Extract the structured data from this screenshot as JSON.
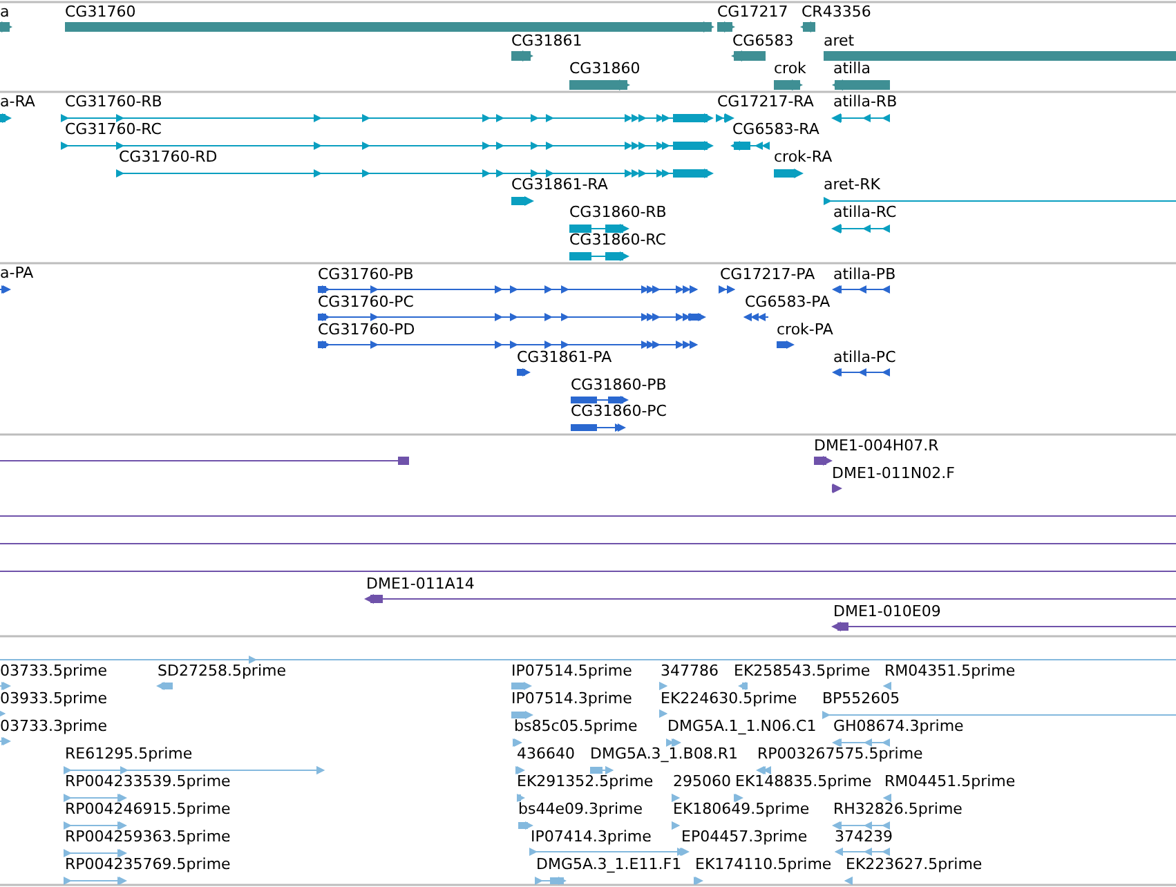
{
  "tracks": [
    {
      "kind": "gene",
      "color": "#3f8f94",
      "features": [
        {
          "label": "a",
          "reverse": false
        },
        {
          "label": "CG31760",
          "reverse": false
        },
        {
          "label": "CG17217",
          "reverse": false
        },
        {
          "label": "CR43356",
          "reverse": true
        },
        {
          "label": "CG31861",
          "reverse": false
        },
        {
          "label": "CG6583",
          "reverse": true
        },
        {
          "label": "aret"
        },
        {
          "label": "CG31860",
          "reverse": false
        },
        {
          "label": "crok",
          "reverse": false
        },
        {
          "label": "atilla",
          "reverse": true
        }
      ]
    },
    {
      "kind": "transcript",
      "color": "#0a9fc0",
      "features": [
        {
          "label": "a-RA",
          "reverse": false
        },
        {
          "label": "CG31760-RB",
          "reverse": false
        },
        {
          "label": "CG17217-RA",
          "reverse": false
        },
        {
          "label": "atilla-RB",
          "reverse": true
        },
        {
          "label": "CG31760-RC",
          "reverse": false
        },
        {
          "label": "CG6583-RA",
          "reverse": true
        },
        {
          "label": "CG31760-RD",
          "reverse": false
        },
        {
          "label": "crok-RA",
          "reverse": false
        },
        {
          "label": "CG31861-RA",
          "reverse": false
        },
        {
          "label": "aret-RK",
          "reverse": false
        },
        {
          "label": "CG31860-RB",
          "reverse": false
        },
        {
          "label": "atilla-RC",
          "reverse": true
        },
        {
          "label": "CG31860-RC",
          "reverse": false
        }
      ]
    },
    {
      "kind": "protein",
      "color": "#2a68d0",
      "features": [
        {
          "label": "a-PA",
          "reverse": false
        },
        {
          "label": "CG31760-PB",
          "reverse": false
        },
        {
          "label": "CG17217-PA",
          "reverse": false
        },
        {
          "label": "atilla-PB",
          "reverse": true
        },
        {
          "label": "CG31760-PC",
          "reverse": false
        },
        {
          "label": "CG6583-PA",
          "reverse": true
        },
        {
          "label": "CG31760-PD",
          "reverse": false
        },
        {
          "label": "crok-PA",
          "reverse": false
        },
        {
          "label": "CG31861-PA",
          "reverse": false
        },
        {
          "label": "atilla-PC",
          "reverse": true
        },
        {
          "label": "CG31860-PB",
          "reverse": false
        },
        {
          "label": "CG31860-PC",
          "reverse": false
        }
      ]
    },
    {
      "kind": "clone",
      "color": "#6f52aa",
      "features": [
        {
          "kind": "span"
        },
        {
          "kind": "clone",
          "label": "DME1-004H07.R",
          "reverse": false
        },
        {
          "kind": "clone",
          "label": "DME1-011N02.F",
          "reverse": false
        },
        {
          "kind": "span"
        },
        {
          "kind": "span"
        },
        {
          "kind": "span"
        },
        {
          "kind": "clone",
          "label": "DME1-011A14",
          "reverse": true
        },
        {
          "kind": "clone",
          "label": "DME1-010E09",
          "reverse": true
        }
      ]
    },
    {
      "kind": "est",
      "color": "#84b9de",
      "features": [
        {
          "reverse": false
        },
        {
          "label": "03733.5prime",
          "reverse": false
        },
        {
          "label": "SD27258.5prime",
          "reverse": true
        },
        {
          "label": "IP07514.5prime",
          "reverse": false
        },
        {
          "label": "347786",
          "reverse": false
        },
        {
          "label": "EK258543.5prime",
          "reverse": true
        },
        {
          "label": "RM04351.5prime",
          "reverse": true
        },
        {
          "label": "03933.5prime",
          "reverse": false
        },
        {
          "label": "IP07514.3prime",
          "reverse": false
        },
        {
          "label": "EK224630.5prime",
          "reverse": false
        },
        {
          "label": "BP552605",
          "reverse": false
        },
        {
          "label": "03733.3prime",
          "reverse": false
        },
        {
          "label": "bs85c05.5prime",
          "reverse": false
        },
        {
          "label": "DMG5A.1_1.N06.C1",
          "reverse": false
        },
        {
          "label": "GH08674.3prime",
          "reverse": true
        },
        {
          "label": "RE61295.5prime",
          "reverse": false
        },
        {
          "label": "436640",
          "reverse": false
        },
        {
          "label": "DMG5A.3_1.B08.R1",
          "reverse": false
        },
        {
          "label": "RP003267575.5prime",
          "reverse": true
        },
        {
          "label": "RP004233539.5prime",
          "reverse": false
        },
        {
          "label": "EK291352.5prime",
          "reverse": false
        },
        {
          "label": "295060",
          "reverse": false
        },
        {
          "label": "EK148835.5prime",
          "reverse": false
        },
        {
          "label": "RM04451.5prime",
          "reverse": true
        },
        {
          "label": "RP004246915.5prime",
          "reverse": false
        },
        {
          "label": "bs44e09.3prime",
          "reverse": false
        },
        {
          "label": "EK180649.5prime",
          "reverse": false
        },
        {
          "label": "RH32826.5prime",
          "reverse": true
        },
        {
          "label": "RP004259363.5prime",
          "reverse": false
        },
        {
          "label": "IP07414.3prime",
          "reverse": false
        },
        {
          "label": "EP04457.3prime"
        },
        {
          "label": "374239",
          "reverse": true
        },
        {
          "label": "RP004235769.5prime",
          "reverse": false
        },
        {
          "label": "DMG5A.3_1.E11.F1",
          "reverse": false
        },
        {
          "label": "EK174110.5prime",
          "reverse": false
        },
        {
          "label": "EK223627.5prime",
          "reverse": true
        }
      ]
    }
  ]
}
